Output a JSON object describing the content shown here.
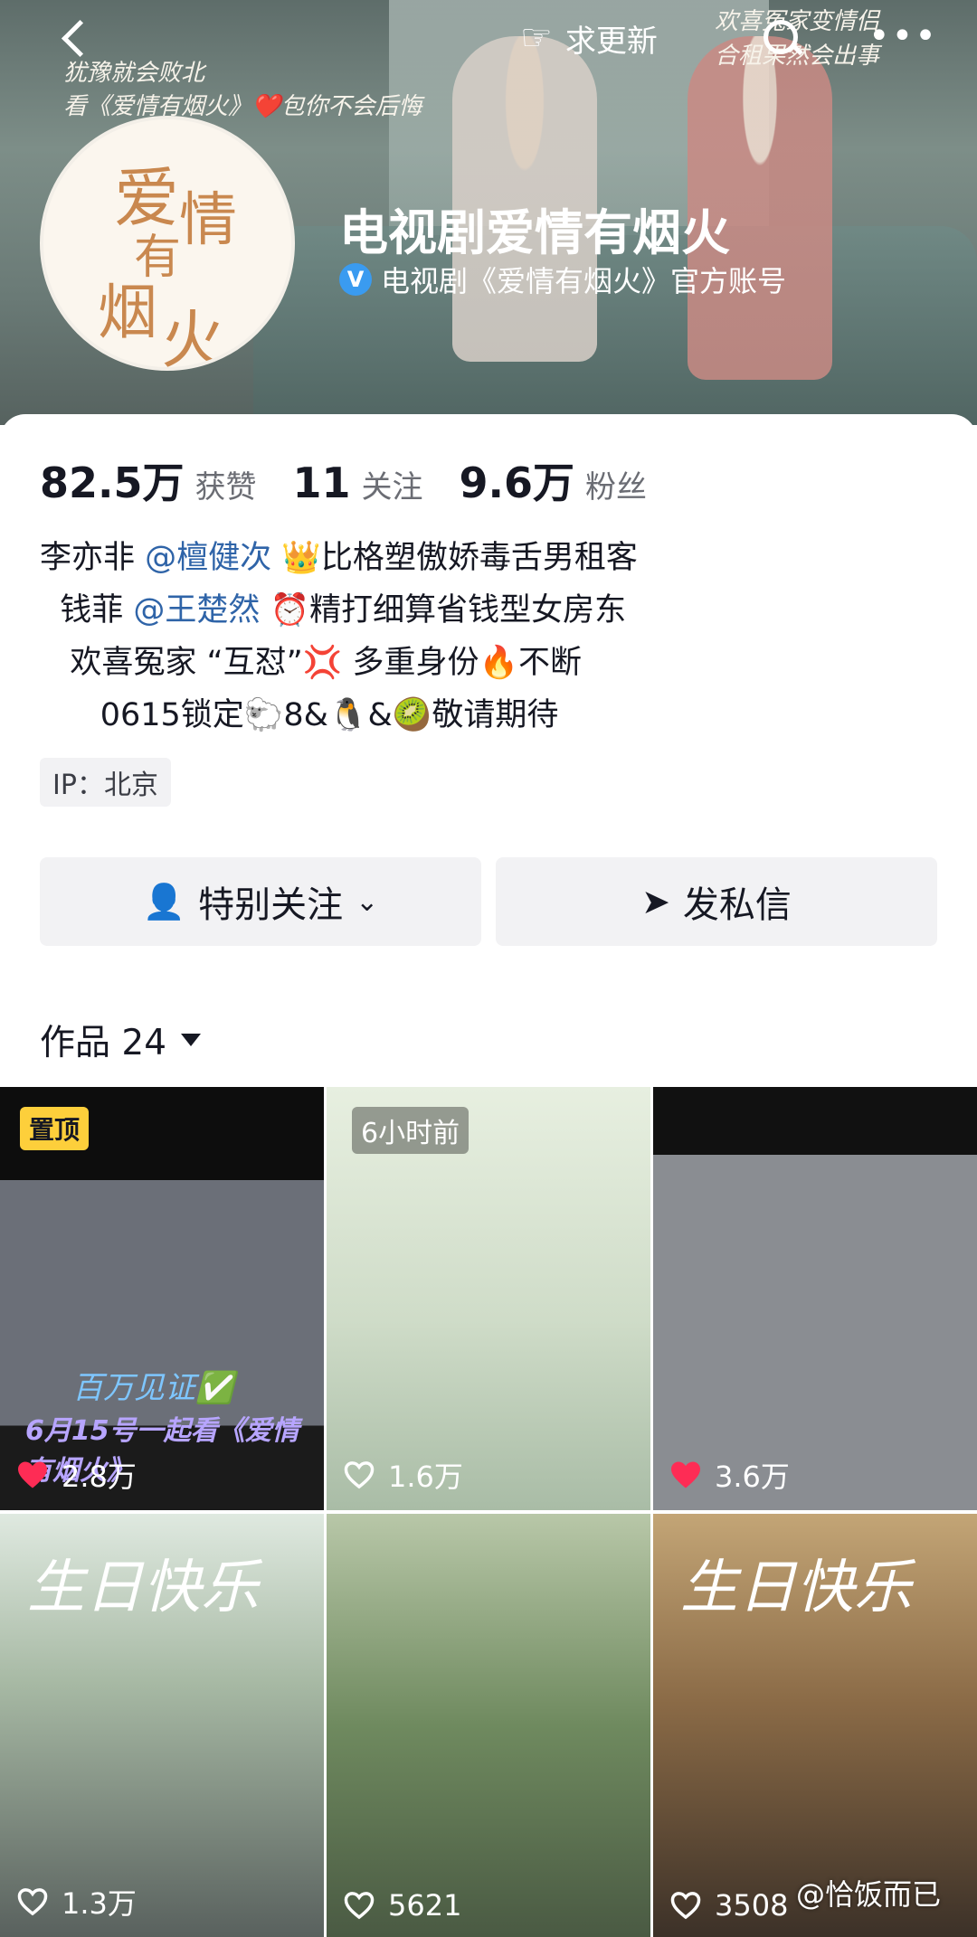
{
  "header": {
    "update_label": "求更新",
    "banner_left_lines": [
      "犹豫就会败北",
      "看《爱情有烟火》❤️包你不会后悔"
    ],
    "banner_right_lines": [
      "欢喜冤家变情侣",
      "合租果然会出事"
    ]
  },
  "profile": {
    "avatar_text": [
      "爱",
      "情",
      "有",
      "烟",
      "火"
    ],
    "name": "电视剧爱情有烟火",
    "verified_text": "电视剧《爱情有烟火》官方账号"
  },
  "stats": [
    {
      "value": "82.5万",
      "label": "获赞"
    },
    {
      "value": "11",
      "label": "关注"
    },
    {
      "value": "9.6万",
      "label": "粉丝"
    }
  ],
  "bio": {
    "l1a": "李亦非 ",
    "l1m": "@檀健次",
    "l1b": " 👑比格塑傲娇毒舌男租客",
    "l2a": "  钱菲 ",
    "l2m": "@王楚然",
    "l2b": " ⏰精打细算省钱型女房东",
    "l3": "   欢喜冤家 “互怼”💢 多重身份🔥不断",
    "l4": "      0615锁定🐑8&🐧&🥝敬请期待"
  },
  "ip_label": "IP：北京",
  "actions": {
    "follow_label": "特别关注",
    "message_label": "发私信"
  },
  "works": {
    "title": "作品 24"
  },
  "tiles": [
    {
      "likes": "2.8万",
      "badge": "置顶",
      "liked": true,
      "caption1": "百万见证✅",
      "caption2": "6月15号一起看《爱情有烟火》"
    },
    {
      "likes": "1.6万",
      "time": "6小时前",
      "liked": false
    },
    {
      "likes": "3.6万",
      "liked": true
    },
    {
      "likes": "1.3万",
      "liked": false,
      "script": "生日快乐"
    },
    {
      "likes": "5621",
      "liked": false
    },
    {
      "likes": "3508",
      "liked": false,
      "script": "生日快乐"
    }
  ],
  "watermark": "@恰饭而已",
  "colors": {
    "accent_blue": "#2f64a8",
    "like_red": "#fe2c55",
    "pin_yellow": "#fdcf3b"
  }
}
